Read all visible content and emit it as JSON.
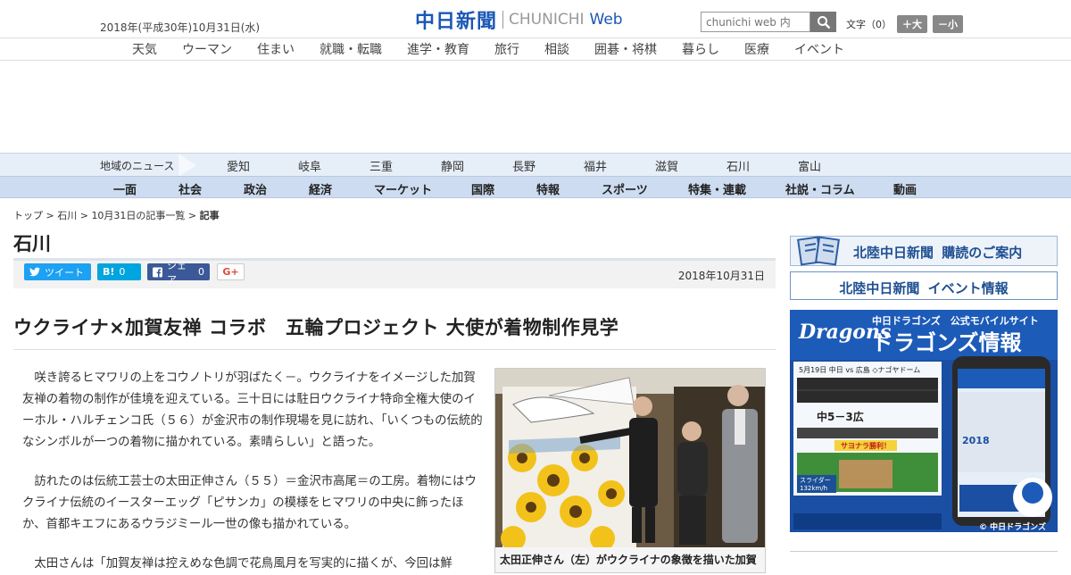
{
  "header": {
    "date": "2018年(平成30年)10月31日(水)",
    "logo_kanji": "中日新聞",
    "logo_en": "CHUNICHI",
    "logo_web": "Web",
    "search_placeholder": "chunichi web 内",
    "font_label": "文字（0）",
    "font_bigger": "＋大",
    "font_smaller": "－小"
  },
  "category_nav": [
    "天気",
    "ウーマン",
    "住まい",
    "就職・転職",
    "進学・教育",
    "旅行",
    "相談",
    "囲碁・将棋",
    "暮らし",
    "医療",
    "イベント"
  ],
  "region_nav": {
    "label": "地域のニュース",
    "items": [
      "愛知",
      "岐阜",
      "三重",
      "静岡",
      "長野",
      "福井",
      "滋賀",
      "石川",
      "富山"
    ]
  },
  "main_nav": [
    "一面",
    "社会",
    "政治",
    "経済",
    "マーケット",
    "国際",
    "特報",
    "スポーツ",
    "特集・連載",
    "社説・コラム",
    "動画"
  ],
  "breadcrumb": {
    "items": [
      "トップ",
      "石川",
      "10月31日の記事一覧"
    ],
    "current": "記事",
    "sep": " > "
  },
  "section_title": "石川",
  "share": {
    "tweet": "ツイート",
    "hatena_label": "B!",
    "hatena_count": "0",
    "fb_label": "シェア",
    "fb_count": "0",
    "gplus": "G+"
  },
  "article": {
    "date": "2018年10月31日",
    "headline": "ウクライナ×加賀友禅 コラボ　五輪プロジェクト 大使が着物制作見学",
    "paragraphs": [
      "咲き誇るヒマワリの上をコウノトリが羽ばたく－。ウクライナをイメージした加賀友禅の着物の制作が佳境を迎えている。三十日には駐日ウクライナ特命全権大使のイーホル・ハルチェンコ氏（５６）が金沢市の制作現場を見に訪れ、「いくつもの伝統的なシンボルが一つの着物に描かれている。素晴らしい」と語った。",
      "訪れたのは伝統工芸士の太田正伸さん（５５）＝金沢市高尾＝の工房。着物にはウクライナ伝統のイースターエッグ「ピサンカ」の模様をヒマワリの中央に飾ったほか、首都キエフにあるウラジミール一世の像も描かれている。",
      "太田さんは「加賀友禅は控えめな色調で花鳥風月を写実的に描くが、今回は鮮"
    ],
    "photo_caption": "太田正伸さん（左）がウクライナの象徴を描いた加賀"
  },
  "sidebar": {
    "banner1_title": "北陸中日新聞",
    "banner1_sub": "購読のご案内",
    "banner2_title": "北陸中日新聞",
    "banner2_sub": "イベント情報",
    "dragons": {
      "logo": "Dragons",
      "top": "中日ドラゴンズ　公式モバイルサイト",
      "title": "ドラゴンズ情報",
      "game": "5月19日 中日 vs 広島 ◇ナゴヤドーム",
      "score": "中5－3広",
      "footer": "© 中日ドラゴンズ",
      "year": "2018",
      "sayonara": "サヨナラ勝利！",
      "pitch_type": "スライダー",
      "speed": "132km/h"
    },
    "colors": {
      "brand_blue": "#1b57b5",
      "dragons_blue": "#1a4fa3"
    }
  }
}
